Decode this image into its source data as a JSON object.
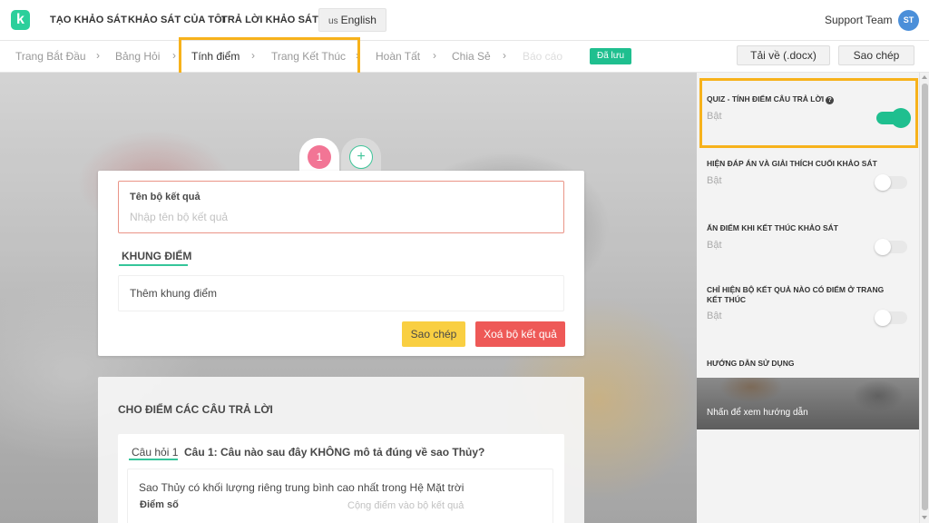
{
  "nav": {
    "logo": "k",
    "items": [
      "TẠO KHẢO SÁT",
      "KHẢO SÁT CỦA TÔI",
      "TRẢ LỜI KHẢO SÁT"
    ],
    "language": {
      "flag": "us",
      "label": "English"
    },
    "team": "Support Team",
    "avatar": "ST"
  },
  "steps": {
    "items": [
      "Trang Bắt Đầu",
      "Bảng Hỏi",
      "Tính điểm",
      "Trang Kết Thúc",
      "Hoàn Tất",
      "Chia Sẻ",
      "Báo cáo"
    ],
    "separator": "›",
    "saved": "Đã lưu",
    "download": "Tải về (.docx)",
    "copy": "Sao chép"
  },
  "result": {
    "tabs": {
      "first": "1",
      "add": "+"
    },
    "name_label": "Tên bộ kết quả",
    "name_placeholder": "Nhập tên bộ kết quả",
    "frame_title": "KHUNG ĐIỂM",
    "add_frame": "Thêm khung điểm",
    "copy_button": "Sao chép",
    "delete_button": "Xoá bộ kết quả"
  },
  "answers": {
    "title": "CHO ĐIỂM CÁC CÂU TRẢ LỜI",
    "question_badge": "Câu hỏi 1",
    "question": "Câu 1: Câu nào sau đây KHÔNG mô tả đúng về sao Thủy?",
    "option_text": "Sao Thủy có khối lượng riêng trung bình cao nhất trong Hệ Mặt trời",
    "score_label": "Điểm số",
    "score_placeholder": "Cộng điểm vào bộ kết quả"
  },
  "sidebar": {
    "options": [
      {
        "title": "QUIZ - TÍNH ĐIỂM CÂU TRẢ LỜI",
        "status": "Bật",
        "on": true,
        "help": "?"
      },
      {
        "title": "HIỆN ĐÁP ÁN VÀ GIẢI THÍCH CUỐI KHẢO SÁT",
        "status": "Bật",
        "on": false
      },
      {
        "title": "ẨN ĐIỂM KHI KẾT THÚC KHẢO SÁT",
        "status": "Bật",
        "on": false
      },
      {
        "title": "CHỈ HIỆN BỘ KẾT QUẢ NÀO CÓ ĐIỂM Ở TRANG KẾT THÚC",
        "status": "Bật",
        "on": false
      }
    ],
    "guide_title": "HƯỚNG DẪN SỬ DỤNG",
    "guide_link": "Nhấn để xem hướng dẫn"
  },
  "colors": {
    "accent": "#1fbf8f",
    "highlight": "#f7b21b",
    "danger": "#ec4744",
    "warning": "#f9ca2d",
    "tab_active": "#f1668a"
  }
}
